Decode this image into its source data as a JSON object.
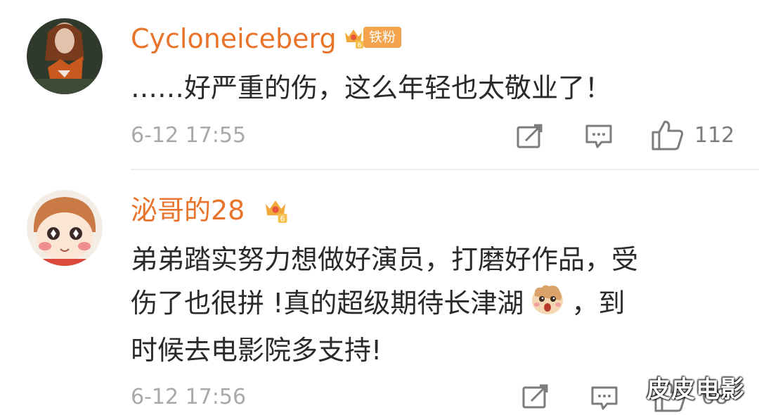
{
  "comments": [
    {
      "username": "Cycloneiceberg",
      "fan_badge": "铁粉",
      "text_lines": [
        "……好严重的伤，这么年轻也太敬业了！"
      ],
      "timestamp": "6-12 17:55",
      "likes": "112",
      "crown_level": "6"
    },
    {
      "username": "泌哥的28",
      "text_lines": [
        "弟弟踏实努力想做好演员，打磨好作品，受",
        "伤了也很拼 !真的超级期待长津湖",
        "，到",
        "时候去电影院多支持!"
      ],
      "timestamp": "6-12 17:56",
      "likes": "68",
      "crown_level": "6"
    }
  ],
  "icons": {
    "repost": "repost-icon",
    "comment": "comment-icon",
    "like": "thumbs-up-icon",
    "crown": "crown-badge-icon",
    "emoji": "surprised-emoji-icon"
  },
  "colors": {
    "username": "#e8742c",
    "text": "#2a2a2a",
    "meta": "#a9a9a9",
    "badge": "#f4a44d"
  },
  "watermark": "皮皮电影"
}
